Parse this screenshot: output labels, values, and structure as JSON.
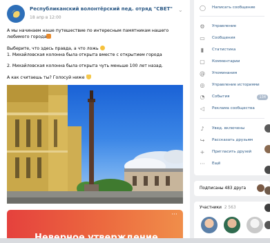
{
  "post": {
    "group_name": "Республиканский волонтёрский пед. отряд \"СВЕТ\"",
    "date": "18 апр в 12:00",
    "menu": "⌄",
    "text": {
      "line1": "А мы начинаем наше путешествие по интересным памятникам нашего любимого",
      "line1b": "города",
      "prompt": "Выберите, что здесь правда, а что ложь",
      "option1": "1. Михайловская колонна была открыта вместе с открытием города",
      "option2": "2. Михайловская колонна была открыта чуть меньше 100 лет назад.",
      "question": "А как считаешь ты? Голосуй ниже"
    },
    "promo": {
      "title": "Неверное утверждение",
      "dots": "···"
    }
  },
  "menu": {
    "items": [
      {
        "label": "Написать сообщение",
        "icon": "chat-icon"
      },
      {
        "label": "Управление",
        "icon": "gear-icon"
      },
      {
        "label": "Сообщения",
        "icon": "message-icon"
      },
      {
        "label": "Статистика",
        "icon": "stats-icon"
      },
      {
        "label": "Комментарии",
        "icon": "comment-icon"
      },
      {
        "label": "Упоминания",
        "icon": "mention-icon"
      },
      {
        "label": "Управление историями",
        "icon": "stories-icon"
      },
      {
        "label": "События",
        "icon": "bell-icon",
        "badge": "134"
      },
      {
        "label": "Реклама сообщества",
        "icon": "megaphone-icon"
      },
      {
        "label": "Увед. включены",
        "icon": "bell-on-icon"
      },
      {
        "label": "Рассказать друзьям",
        "icon": "share-icon"
      },
      {
        "label": "Пригласить друзей",
        "icon": "invite-icon"
      },
      {
        "label": "Ещё",
        "icon": "more-icon"
      }
    ]
  },
  "friends": {
    "label": "Подписаны 483 друга"
  },
  "members": {
    "label": "Участники",
    "count": "2 563"
  },
  "colors": {
    "link": "#2a5885",
    "promo_start": "#e5413d",
    "promo_end": "#f08e4a",
    "background": "#edeef0"
  }
}
